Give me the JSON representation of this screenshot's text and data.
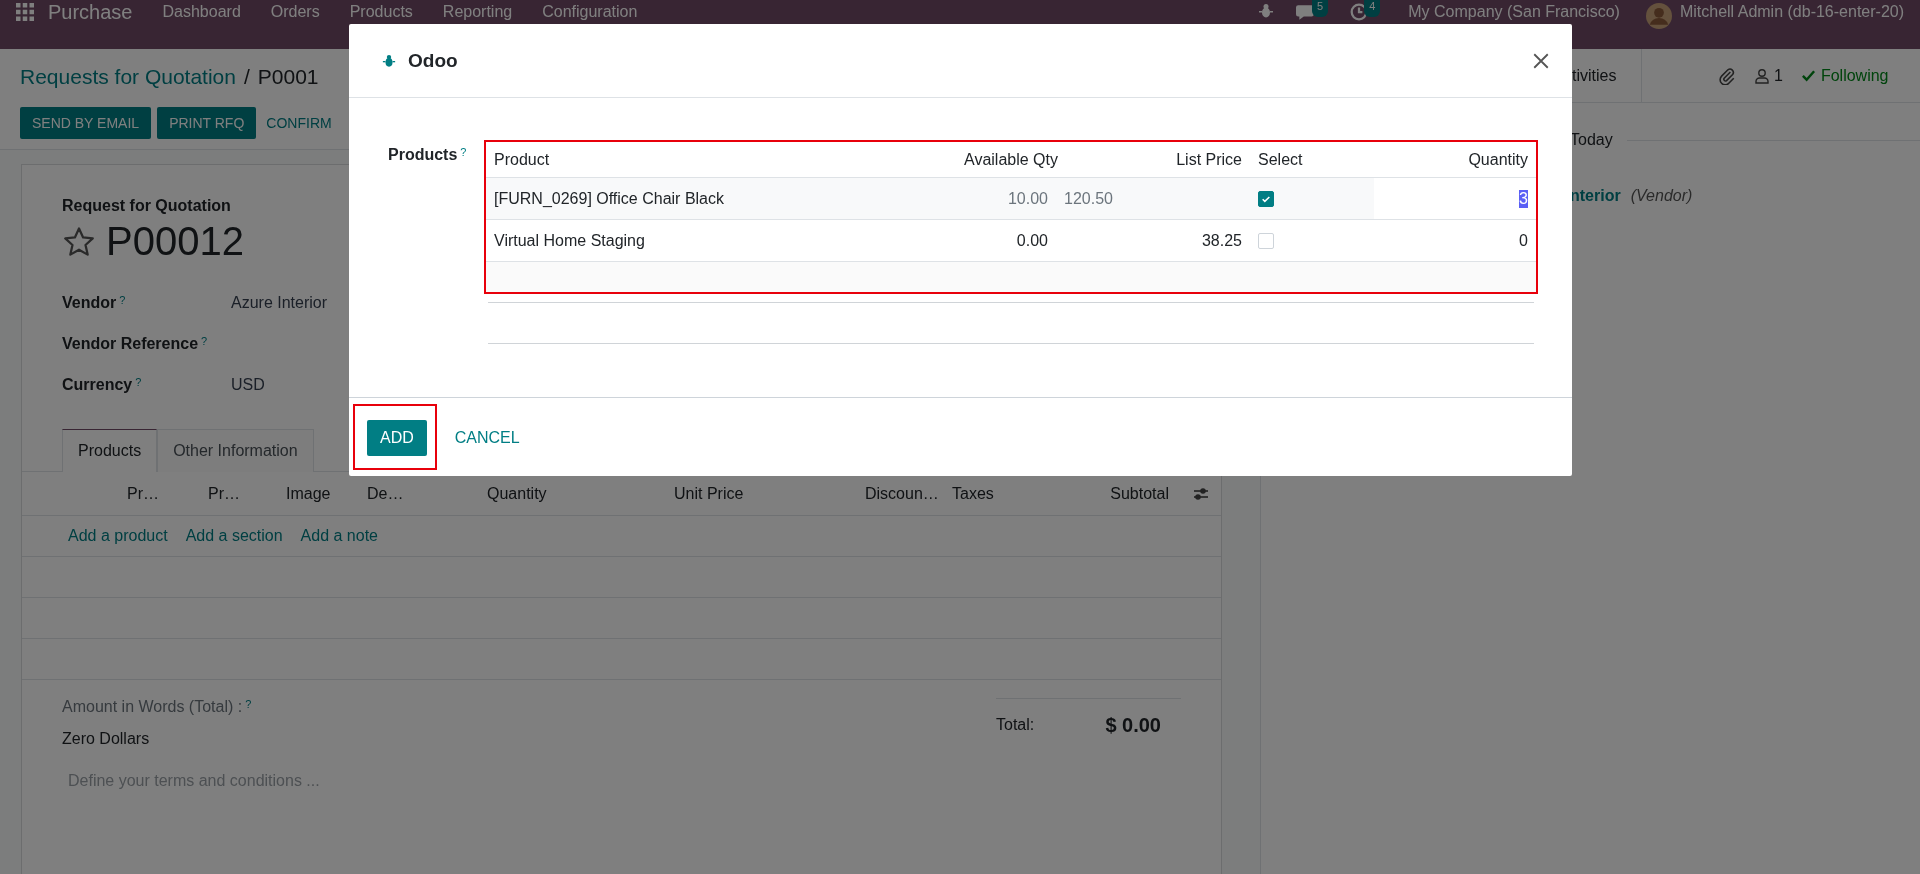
{
  "navbar": {
    "app_name": "Purchase",
    "menu": [
      "Dashboard",
      "Orders",
      "Products",
      "Reporting",
      "Configuration"
    ],
    "message_count": "5",
    "activity_count": "4",
    "company": "My Company (San Francisco)",
    "user": "Mitchell Admin (db-16-enter-20)"
  },
  "breadcrumb": {
    "parent": "Requests for Quotation",
    "separator": "/",
    "current": "P0001"
  },
  "actions": [
    {
      "label": "SEND BY EMAIL",
      "kind": "primary"
    },
    {
      "label": "PRINT RFQ",
      "kind": "primary"
    },
    {
      "label": "CONFIRM",
      "kind": "secondary"
    }
  ],
  "chatter": {
    "activities_button": "tivities",
    "follower_count": "1",
    "follow_label": "Following",
    "day_separator": "Today",
    "author": "nterior",
    "author_role": "(Vendor)"
  },
  "form": {
    "type_label": "Request for Quotation",
    "name": "P00012",
    "starred": false,
    "fields": [
      {
        "label": "Vendor",
        "help_mark": "?",
        "value": "Azure Interior"
      },
      {
        "label": "Vendor Reference",
        "help_mark": "?"
      },
      {
        "label": "Currency",
        "help_mark": "?",
        "value": "USD"
      }
    ],
    "tabs": [
      {
        "label": "Products",
        "selected": true
      },
      {
        "label": "Other Information",
        "selected": false
      }
    ],
    "line_columns": [
      "Pr…",
      "Pr…",
      "Image",
      "De…",
      "Quantity",
      "Unit Price",
      "Discoun…",
      "Taxes",
      "Subtotal"
    ],
    "add_links": [
      "Add a product",
      "Add a section",
      "Add a note"
    ],
    "amount_words_label": "Amount in Words (Total) :",
    "amount_words_help": "?",
    "amount_words": "Zero Dollars",
    "terms_placeholder": "Define your terms and conditions ...",
    "total_label": "Total:",
    "total": "$ 0.00"
  },
  "dialog": {
    "title": "Odoo",
    "field_label": "Products",
    "field_help": "?",
    "table_highlighted": true,
    "columns": [
      "Product",
      "Available Qty",
      "List Price",
      "Select",
      "Quantity"
    ],
    "rows": [
      {
        "product": "[FURN_0269] Office Chair Black",
        "available_qty": "10.00",
        "list_price": "120.50",
        "selected": true,
        "editing": true,
        "quantity": "3"
      },
      {
        "product": "Virtual Home Staging",
        "available_qty": "0.00",
        "list_price": "38.25",
        "selected": false,
        "editing": false,
        "quantity": "0"
      }
    ],
    "buttons": [
      {
        "label": "ADD",
        "kind": "primary",
        "highlighted": true
      },
      {
        "label": "CANCEL",
        "kind": "link",
        "highlighted": false
      }
    ]
  }
}
